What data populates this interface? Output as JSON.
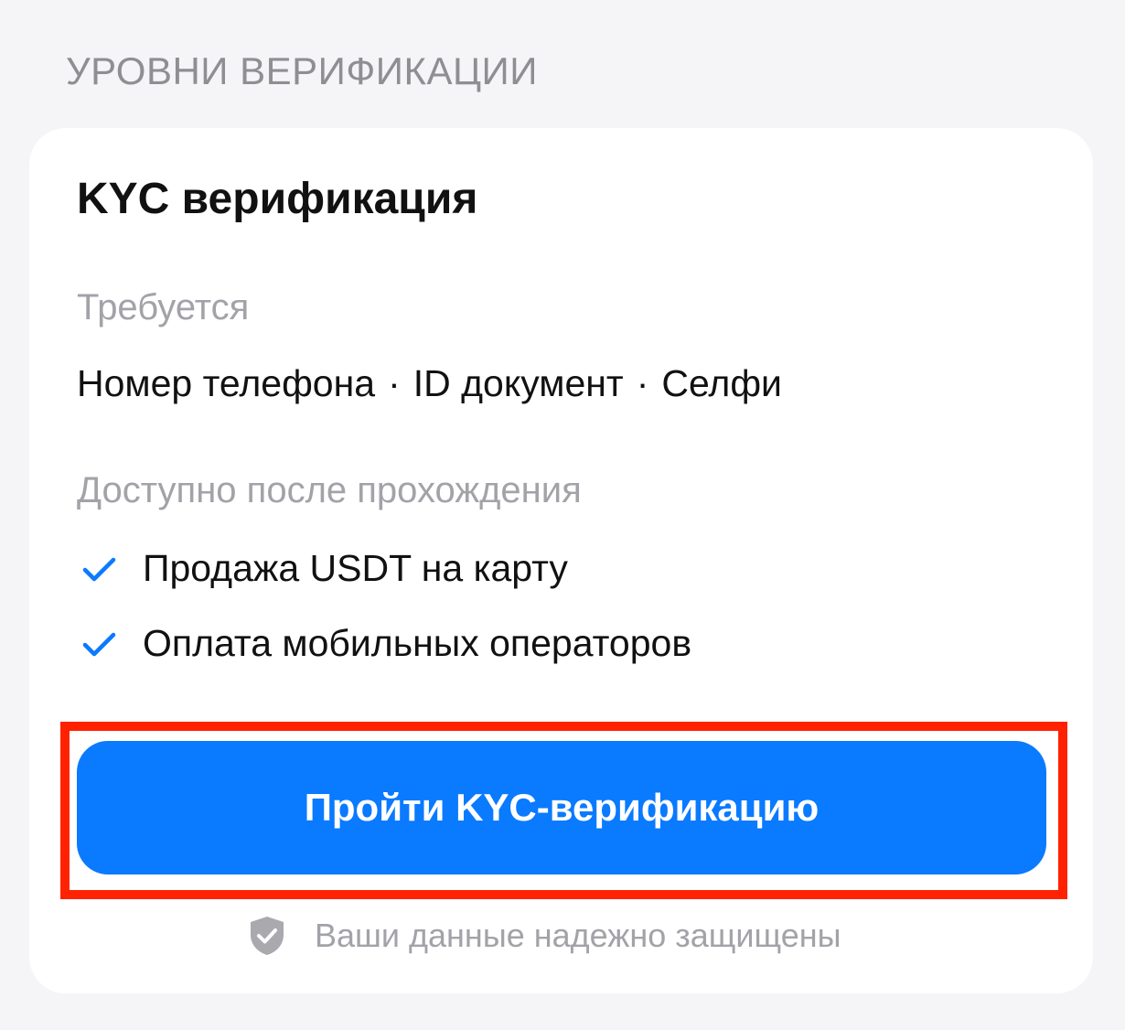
{
  "section": {
    "title": "УРОВНИ ВЕРИФИКАЦИИ"
  },
  "card": {
    "title": "KYC верификация",
    "required_label": "Требуется",
    "requirements": [
      "Номер телефона",
      "ID документ",
      "Селфи"
    ],
    "separator": "·",
    "available_label": "Доступно после прохождения",
    "features": [
      {
        "label": "Продажа USDT на карту",
        "icon": "checkmark-icon"
      },
      {
        "label": "Оплата мобильных операторов",
        "icon": "checkmark-icon"
      }
    ],
    "button_label": "Пройти KYC-верификацию",
    "secure_note": "Ваши данные надежно защищены",
    "secure_icon": "shield-check-icon"
  },
  "colors": {
    "accent": "#0a7aff",
    "highlight": "#ff2200",
    "muted_text": "#a2a2a8",
    "background": "#f5f5f7",
    "card": "#ffffff"
  }
}
